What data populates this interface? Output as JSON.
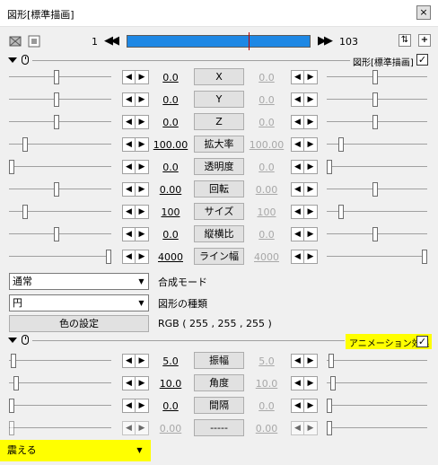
{
  "window": {
    "title": "図形[標準描画]",
    "close_label": "×"
  },
  "timeline": {
    "start_frame": "1",
    "end_frame": "103",
    "prev_label": "◀◀",
    "next_label": "▶▶",
    "cursor_position_fraction": 0.665,
    "bar_color": "#1e88e5"
  },
  "section1": {
    "label": "図形[標準描画]",
    "checked_label": "✓"
  },
  "params": [
    {
      "name": "X",
      "left": "0.0",
      "right": "0.0",
      "left_thumb": 0.46,
      "right_thumb": 0.48
    },
    {
      "name": "Y",
      "left": "0.0",
      "right": "0.0",
      "left_thumb": 0.46,
      "right_thumb": 0.48
    },
    {
      "name": "Z",
      "left": "0.0",
      "right": "0.0",
      "left_thumb": 0.46,
      "right_thumb": 0.48
    },
    {
      "name": "拡大率",
      "left": "100.00",
      "right": "100.00",
      "left_thumb": 0.14,
      "right_thumb": 0.12
    },
    {
      "name": "透明度",
      "left": "0.0",
      "right": "0.0",
      "left_thumb": 0.0,
      "right_thumb": 0.0
    },
    {
      "name": "回転",
      "left": "0.00",
      "right": "0.00",
      "left_thumb": 0.46,
      "right_thumb": 0.48
    },
    {
      "name": "サイズ",
      "left": "100",
      "right": "100",
      "left_thumb": 0.14,
      "right_thumb": 0.12
    },
    {
      "name": "縦横比",
      "left": "0.0",
      "right": "0.0",
      "left_thumb": 0.46,
      "right_thumb": 0.48
    },
    {
      "name": "ライン幅",
      "left": "4000",
      "right": "4000",
      "left_thumb": 1.0,
      "right_thumb": 1.0
    }
  ],
  "blend": {
    "value": "通常",
    "label": "合成モード"
  },
  "shape": {
    "value": "円",
    "label": "図形の種類"
  },
  "color": {
    "button_label": "色の設定",
    "rgb_text": "RGB ( 255 , 255 , 255 )"
  },
  "section2": {
    "label": "アニメーション効果",
    "checked_label": "✓",
    "highlight_color": "#ffff00"
  },
  "anim_params": [
    {
      "name": "振幅",
      "left": "5.0",
      "right": "5.0",
      "left_thumb": 0.02,
      "right_thumb": 0.02,
      "enabled": true
    },
    {
      "name": "角度",
      "left": "10.0",
      "right": "10.0",
      "left_thumb": 0.05,
      "right_thumb": 0.04,
      "enabled": true
    },
    {
      "name": "間隔",
      "left": "0.0",
      "right": "0.0",
      "left_thumb": 0.0,
      "right_thumb": 0.0,
      "enabled": true
    },
    {
      "name": "-----",
      "left": "0.00",
      "right": "0.00",
      "left_thumb": 0.0,
      "right_thumb": 0.0,
      "enabled": false
    }
  ],
  "effect": {
    "value": "震える"
  },
  "step_labels": {
    "left": "◀",
    "right": "▶"
  },
  "dropdown_arrow": "▼"
}
